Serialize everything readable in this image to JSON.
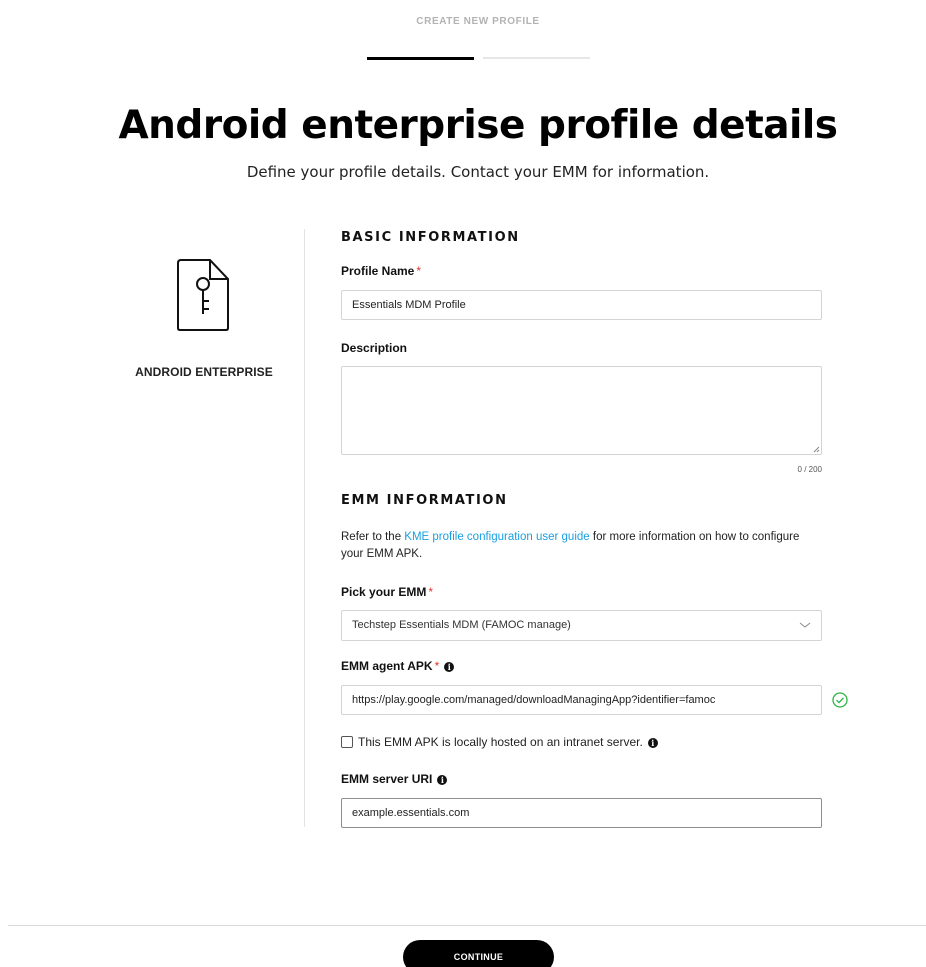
{
  "header": {
    "step_label": "CREATE NEW PROFILE",
    "steps_total": 2,
    "current_step": 1
  },
  "page": {
    "title": "Android enterprise profile details",
    "subtitle": "Define your profile details. Contact your EMM for information."
  },
  "sidebar": {
    "icon": "key-document-icon",
    "label": "ANDROID ENTERPRISE"
  },
  "basic_info": {
    "section_title": "BASIC INFORMATION",
    "profile_name_label": "Profile Name",
    "profile_name_value": "Essentials MDM Profile",
    "description_label": "Description",
    "description_value": "",
    "char_count": "0 / 200"
  },
  "emm_info": {
    "section_title": "EMM INFORMATION",
    "help_prefix": "Refer to the ",
    "help_link": "KME profile configuration user guide",
    "help_suffix": " for more information on how to configure your EMM APK.",
    "pick_emm_label": "Pick your EMM",
    "pick_emm_value": "Techstep Essentials MDM (FAMOC manage)",
    "agent_apk_label": "EMM agent APK",
    "agent_apk_value": "https://play.google.com/managed/downloadManagingApp?identifier=famoc",
    "local_host_label": "This EMM APK is locally hosted on an intranet server.",
    "server_uri_label": "EMM server URI",
    "server_uri_value": "example.essentials.com"
  },
  "required_marker": "*",
  "info_glyph": "i",
  "footer": {
    "continue_label": "CONTINUE"
  },
  "colors": {
    "required": "#e0342c",
    "link": "#1aa0e0",
    "valid": "#2fb344",
    "primary_button": "#000000"
  }
}
